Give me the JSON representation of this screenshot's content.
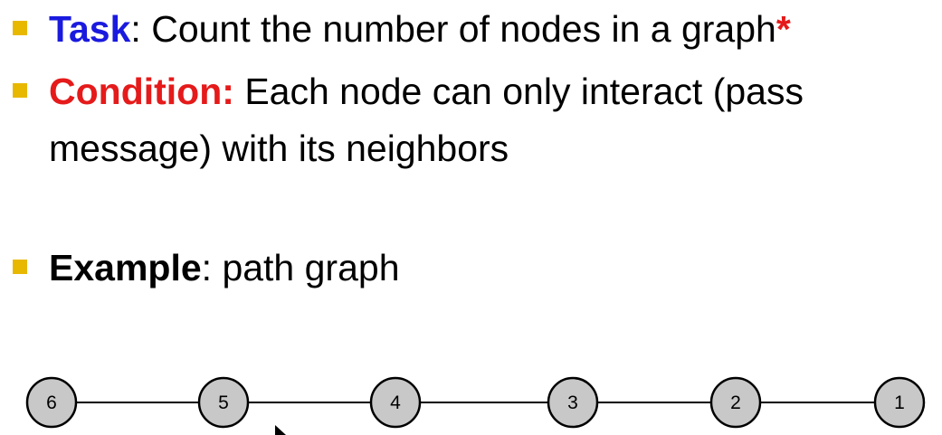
{
  "slide": {
    "bullets": [
      {
        "keyword": "Task",
        "text": ": Count the number of nodes in a graph",
        "marker": "*"
      },
      {
        "keyword": "Condition:",
        "text_line1": " Each node can only interact (pass",
        "text_line2": "message) with its neighbors"
      },
      {
        "keyword": "Example",
        "text": ": path graph"
      }
    ]
  },
  "graph": {
    "type": "path",
    "nodes": [
      "6",
      "5",
      "4",
      "3",
      "2",
      "1"
    ]
  },
  "colors": {
    "task": "#1a1adf",
    "condition": "#e51a1a",
    "bullet": "#e8b800",
    "node_fill": "#c8c8c8"
  }
}
